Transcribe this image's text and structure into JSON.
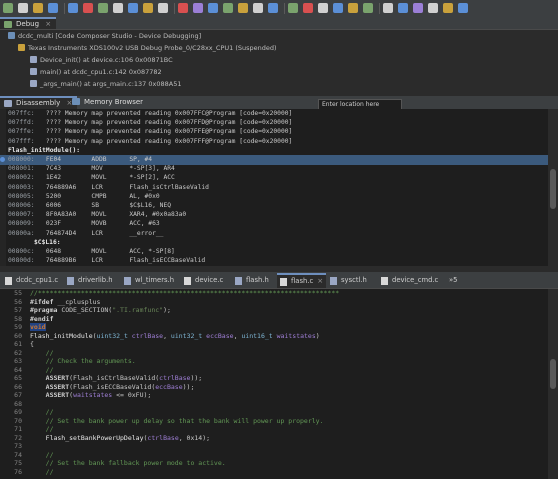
{
  "debug": {
    "tab_label": "Debug",
    "tree": [
      {
        "text": "dcdc_multi [Code Composer Studio - Device Debugging]"
      },
      {
        "text": "Texas Instruments XDS100v2 USB Debug Probe_0/C28xx_CPU1 (Suspended)"
      },
      {
        "text": "Device_init() at device.c:106 0x00871BC"
      },
      {
        "text": "main() at dcdc_cpu1.c:142 0x087782"
      },
      {
        "text": "_args_main() at args_main.c:137 0x088A51"
      }
    ]
  },
  "disasm": {
    "tab_label": "Disassembly",
    "memory_tab_label": "Memory Browser",
    "location_placeholder": "Enter location here",
    "lines": [
      {
        "addr": "007ffc:",
        "text": "???? Memory map prevented reading 0x007FFC@Program [code=0x20000]"
      },
      {
        "addr": "007ffd:",
        "text": "???? Memory map prevented reading 0x007FFD@Program [code=0x20000]"
      },
      {
        "addr": "007ffe:",
        "text": "???? Memory map prevented reading 0x007FFE@Program [code=0x20000]"
      },
      {
        "addr": "007fff:",
        "text": "???? Memory map prevented reading 0x007FFF@Program [code=0x20000]"
      },
      {
        "addr": "",
        "text": "Flash_initModule():"
      },
      {
        "addr": "008000:",
        "text": "FE04        ADDB      SP, #4"
      },
      {
        "addr": "008001:",
        "text": "7C43        MOV       *-SP[3], AR4"
      },
      {
        "addr": "008002:",
        "text": "1E42        MOVL      *-SP[2], ACC"
      },
      {
        "addr": "008003:",
        "text": "764889A6    LCR       Flash_isCtrlBaseValid"
      },
      {
        "addr": "008005:",
        "text": "5200        CMPB      AL, #0x0"
      },
      {
        "addr": "008006:",
        "text": "6006        SB        $C$L16, NEQ"
      },
      {
        "addr": "008007:",
        "text": "8F0A83A0    MOVL      XAR4, #0x0a83a0"
      },
      {
        "addr": "008009:",
        "text": "023F        MOVB      ACC, #63"
      },
      {
        "addr": "00800a:",
        "text": "764874D4    LCR       __error__"
      },
      {
        "addr": "",
        "text": "$C$L16:"
      },
      {
        "addr": "00800c:",
        "text": "0648        MOVL      ACC, *-SP[8]"
      },
      {
        "addr": "00800d:",
        "text": "764889B6    LCR       Flash_isECCBaseValid"
      }
    ]
  },
  "editor": {
    "tabs": [
      {
        "label": "dcdc_cpu1.c",
        "type": "c"
      },
      {
        "label": "driverlib.h",
        "type": "h"
      },
      {
        "label": "wl_timers.h",
        "type": "h"
      },
      {
        "label": "device.c",
        "type": "c"
      },
      {
        "label": "flash.h",
        "type": "h"
      },
      {
        "label": "flash.c",
        "type": "c",
        "active": true
      },
      {
        "label": "sysctl.h",
        "type": "h"
      },
      {
        "label": "device_cmd.c",
        "type": "c"
      },
      {
        "label": "»5",
        "type": "more"
      }
    ],
    "lines": [
      {
        "n": "55",
        "html": "<span class=\"cm\">//*****************************************************************************</span>"
      },
      {
        "n": "56",
        "html": "<span class=\"pp\">#ifdef</span> __cplusplus"
      },
      {
        "n": "57",
        "html": "<span class=\"pp\">#pragma</span> CODE_SECTION(<span class=\"str\">\".TI.ramfunc\"</span>);"
      },
      {
        "n": "58",
        "html": "<span class=\"pp\">#endif</span>"
      },
      {
        "n": "59",
        "html": "<span class=\"kw caret-hl\">void</span>"
      },
      {
        "n": "60",
        "html": "<span class=\"fn\">Flash_initModule</span>(<span class=\"ty\">uint32_t</span> <span class=\"par\">ctrlBase</span>, <span class=\"ty\">uint32_t</span> <span class=\"par\">eccBase</span>, <span class=\"ty\">uint16_t</span> <span class=\"par\">waitstates</span>)"
      },
      {
        "n": "61",
        "html": "{"
      },
      {
        "n": "62",
        "html": "    <span class=\"cm\">//</span>"
      },
      {
        "n": "63",
        "html": "    <span class=\"cm\">// Check the arguments.</span>"
      },
      {
        "n": "64",
        "html": "    <span class=\"cm\">//</span>"
      },
      {
        "n": "65",
        "html": "    <span class=\"pp\">ASSERT</span>(Flash_isCtrlBaseValid(<span class=\"par\">ctrlBase</span>));"
      },
      {
        "n": "66",
        "html": "    <span class=\"pp\">ASSERT</span>(Flash_isECCBaseValid(<span class=\"par\">eccBase</span>));"
      },
      {
        "n": "67",
        "html": "    <span class=\"pp\">ASSERT</span>(<span class=\"par\">waitstates</span> &lt;= 0xFU);"
      },
      {
        "n": "68",
        "html": ""
      },
      {
        "n": "69",
        "html": "    <span class=\"cm\">//</span>"
      },
      {
        "n": "70",
        "html": "    <span class=\"cm\">// Set the bank power up delay so that the bank will power up properly.</span>"
      },
      {
        "n": "71",
        "html": "    <span class=\"cm\">//</span>"
      },
      {
        "n": "72",
        "html": "    <span class=\"fn\">Flash_setBankPowerUpDelay</span>(<span class=\"par\">ctrlBase</span>, 0x14);"
      },
      {
        "n": "73",
        "html": ""
      },
      {
        "n": "74",
        "html": "    <span class=\"cm\">//</span>"
      },
      {
        "n": "75",
        "html": "    <span class=\"cm\">// Set the bank fallback power mode to active.</span>"
      },
      {
        "n": "76",
        "html": "    <span class=\"cm\">//</span>"
      }
    ]
  },
  "colors": {
    "accent": "#6e8fbe",
    "selection": "#3b5a7d",
    "editor_bg": "#1e1e1e",
    "comment": "#629755",
    "keyword": "#cc7832"
  }
}
